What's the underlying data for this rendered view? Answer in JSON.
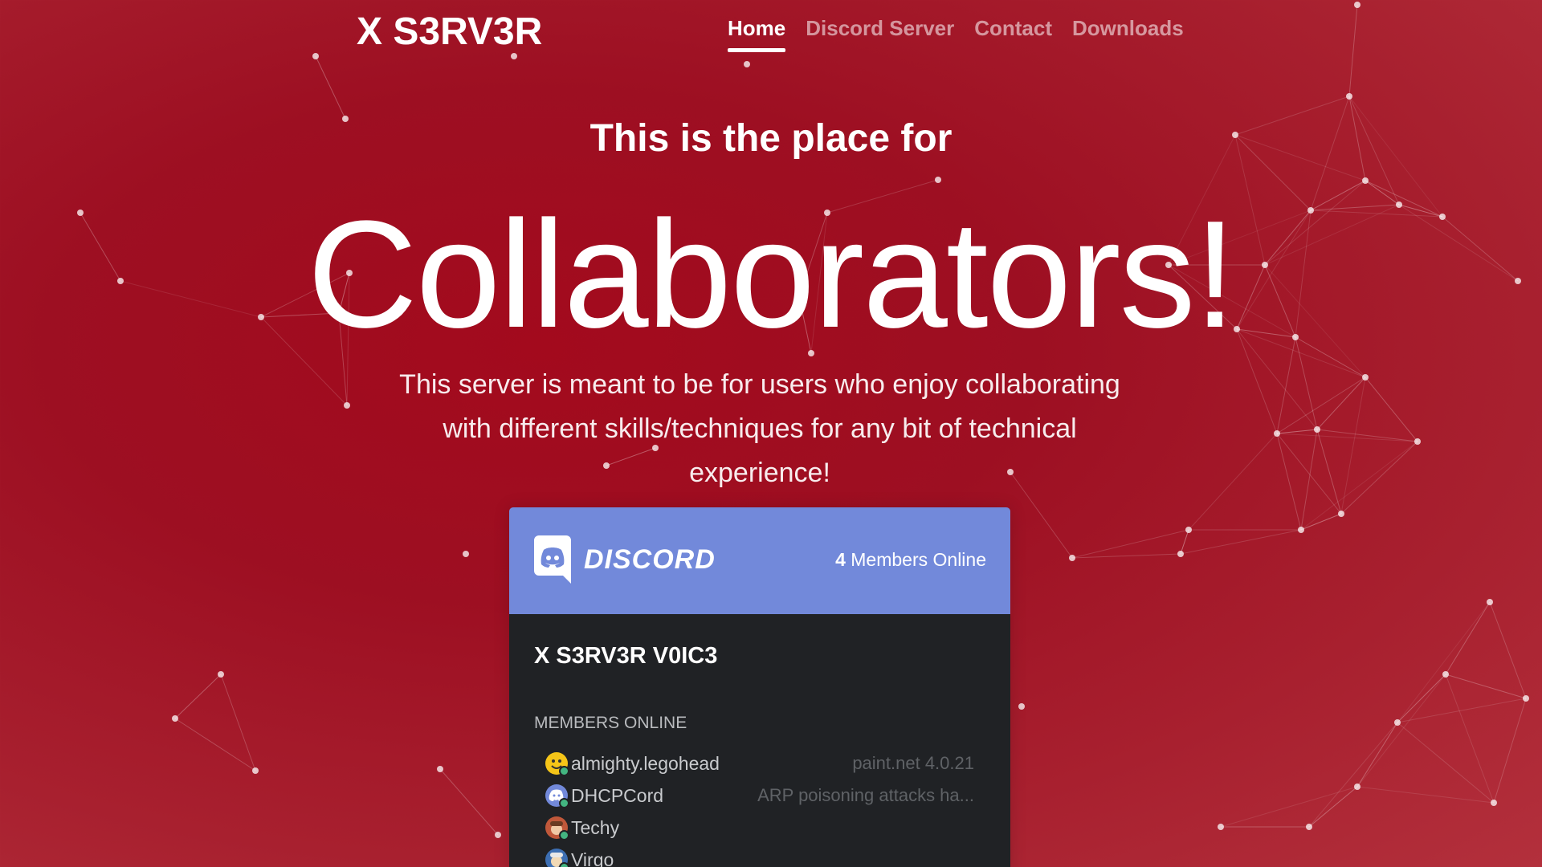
{
  "header": {
    "brand": "X S3RV3R",
    "nav": [
      {
        "label": "Home",
        "active": true
      },
      {
        "label": "Discord Server",
        "active": false
      },
      {
        "label": "Contact",
        "active": false
      },
      {
        "label": "Downloads",
        "active": false
      }
    ]
  },
  "hero": {
    "pre_title": "This is the place for",
    "title": "Collaborators!",
    "subtitle": "This server is meant to be for users who enjoy collaborating with different skills/techniques for any bit of technical experience!"
  },
  "widget": {
    "logo_text": "DISCORD",
    "online_count": "4",
    "online_label": "Members Online",
    "server_name": "X S3RV3R V0IC3",
    "members_label": "MEMBERS ONLINE",
    "members": [
      {
        "name": "almighty.legohead",
        "game": "paint.net 4.0.21",
        "avatar_icon": "smiley-avatar-icon"
      },
      {
        "name": "DHCPCord",
        "game": "ARP poisoning attacks ha...",
        "avatar_icon": "discord-default-avatar-icon"
      },
      {
        "name": "Techy",
        "game": "",
        "avatar_icon": "character-avatar-icon"
      },
      {
        "name": "Virgo",
        "game": "",
        "avatar_icon": "character-avatar-icon"
      }
    ]
  },
  "colors": {
    "background": "#a30a1d",
    "discord_blurple": "#7289da",
    "widget_body": "#202225",
    "status_online": "#43b581"
  }
}
